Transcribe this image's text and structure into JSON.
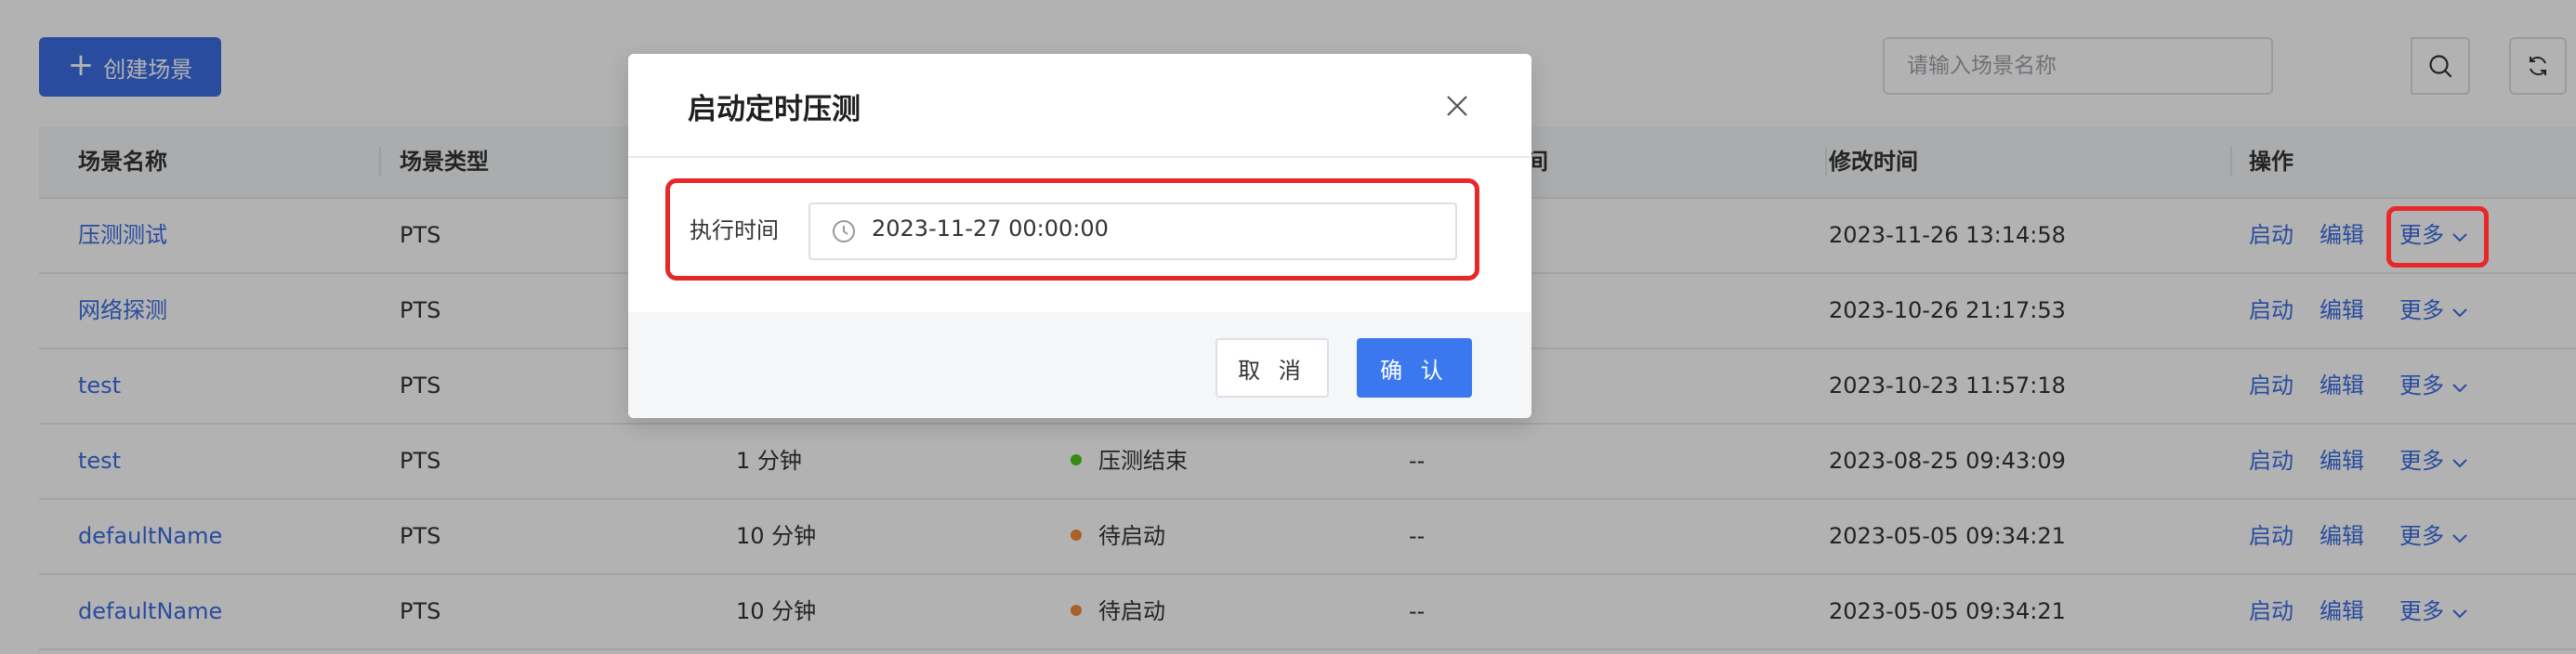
{
  "toolbar": {
    "create_label": "创建场景",
    "search_placeholder": "请输入场景名称"
  },
  "table": {
    "headers": [
      "场景名称",
      "场景类型",
      "",
      "",
      "间",
      "修改时间",
      "操作"
    ],
    "rows": [
      {
        "name": "压测测试",
        "type": "PTS",
        "duration": "",
        "status": "",
        "status_color": "",
        "last_run": "",
        "modified": "2023-11-26 13:14:58"
      },
      {
        "name": "网络探测",
        "type": "PTS",
        "duration": "",
        "status": "",
        "status_color": "",
        "last_run": "",
        "modified": "2023-10-26 21:17:53"
      },
      {
        "name": "test",
        "type": "PTS",
        "duration": "",
        "status": "",
        "status_color": "",
        "last_run": "",
        "modified": "2023-10-23 11:57:18"
      },
      {
        "name": "test",
        "type": "PTS",
        "duration": "1 分钟",
        "status": "压测结束",
        "status_color": "#52c41a",
        "last_run": "--",
        "modified": "2023-08-25 09:43:09"
      },
      {
        "name": "defaultName",
        "type": "PTS",
        "duration": "10 分钟",
        "status": "待启动",
        "status_color": "#f08c3c",
        "last_run": "--",
        "modified": "2023-05-05 09:34:21"
      },
      {
        "name": "defaultName",
        "type": "PTS",
        "duration": "10 分钟",
        "status": "待启动",
        "status_color": "#f08c3c",
        "last_run": "--",
        "modified": "2023-05-05 09:34:21"
      }
    ],
    "actions": {
      "start": "启动",
      "edit": "编辑",
      "more": "更多"
    }
  },
  "modal": {
    "title": "启动定时压测",
    "field_label": "执行时间",
    "field_value": "2023-11-27 00:00:00",
    "cancel_label": "取 消",
    "confirm_label": "确 认"
  },
  "colors": {
    "primary": "#3b6de3",
    "highlight": "#e8272b",
    "status_done": "#52c41a",
    "status_pending": "#f08c3c"
  },
  "icons": [
    "plus-icon",
    "search-icon",
    "refresh-icon",
    "close-icon",
    "clock-icon",
    "chevron-down-icon"
  ]
}
